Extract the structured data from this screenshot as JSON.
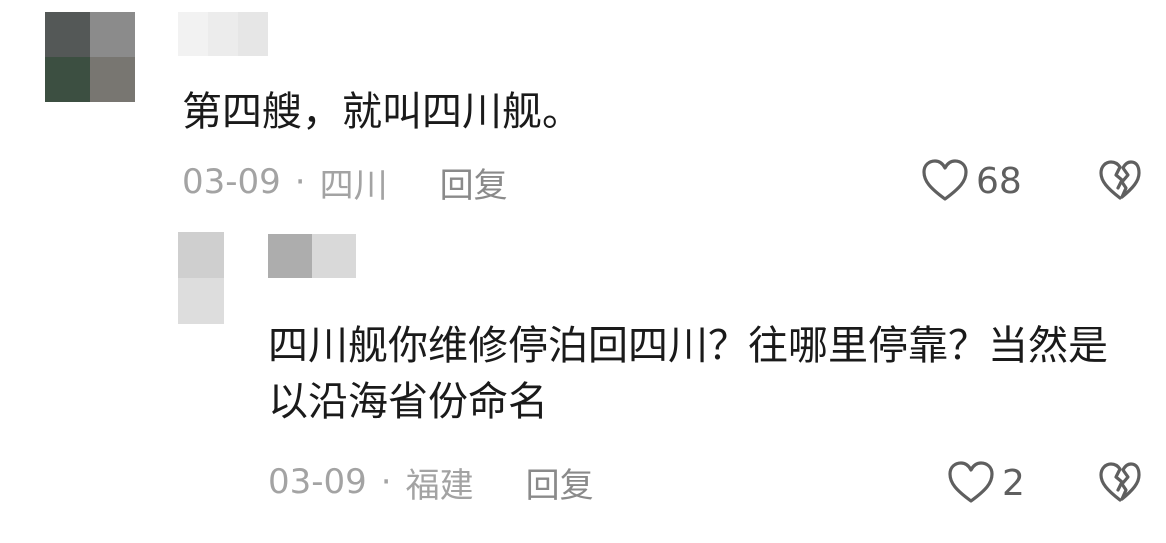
{
  "comment": {
    "text": "第四艘，就叫四川舰。",
    "date": "03-09",
    "separator": "·",
    "location": "四川",
    "reply_label": "回复",
    "likes": "68",
    "reply": {
      "text": "四川舰你维修停泊回四川？往哪里停靠？当然是以沿海省份命名",
      "date": "03-09",
      "separator": "·",
      "location": "福建",
      "reply_label": "回复",
      "likes": "2"
    }
  },
  "icons": {
    "like": "heart-outline-icon",
    "dislike": "broken-heart-icon"
  },
  "colors": {
    "text": "#1a1a1a",
    "meta": "#a3a3a3",
    "icon": "#5f5f5f",
    "background": "#ffffff"
  }
}
